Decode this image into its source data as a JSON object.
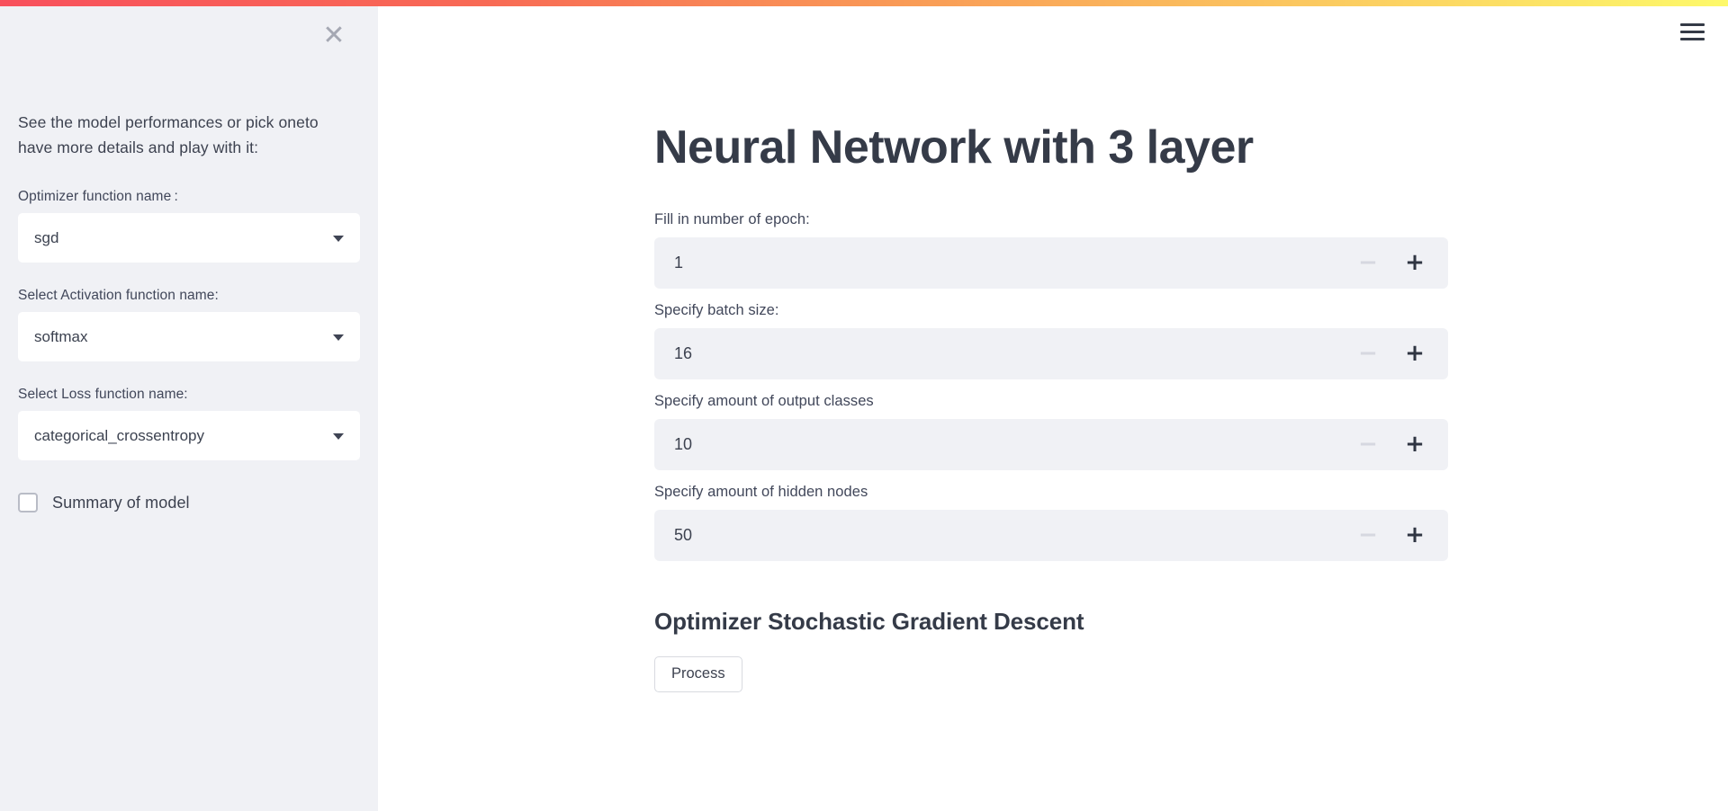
{
  "topbar": {
    "gradient_from": "#f8505c",
    "gradient_to": "#fdf96a",
    "menu_icon": "hamburger-menu-icon"
  },
  "sidebar": {
    "close_icon": "✕",
    "intro_text": "See the model performances or pick oneto have more details and play with it:",
    "selects": [
      {
        "label": "Optimizer function name :",
        "value": "sgd",
        "caret_icon": "chevron-down-icon"
      },
      {
        "label": "Select Activation function name:",
        "value": "softmax",
        "caret_icon": "chevron-down-icon"
      },
      {
        "label": "Select Loss function name:",
        "value": "categorical_crossentropy",
        "caret_icon": "chevron-down-icon"
      }
    ],
    "checkbox": {
      "label": "Summary of model",
      "checked": false
    }
  },
  "main": {
    "title": "Neural Network with 3 layer",
    "number_fields": [
      {
        "label": "Fill in number of epoch:",
        "value": "1",
        "minus": "−",
        "plus": "+"
      },
      {
        "label": "Specify batch size:",
        "value": "16",
        "minus": "−",
        "plus": "+"
      },
      {
        "label": "Specify amount of output classes",
        "value": "10",
        "minus": "−",
        "plus": "+"
      },
      {
        "label": "Specify amount of hidden nodes",
        "value": "50",
        "minus": "−",
        "plus": "+"
      }
    ],
    "optimizer_heading": "Optimizer Stochastic Gradient Descent",
    "process_button": "Process"
  },
  "colors": {
    "sidebar_bg": "#f0f1f5",
    "input_bg": "#f0f1f5",
    "text": "#3d4250",
    "title": "#353b48"
  }
}
